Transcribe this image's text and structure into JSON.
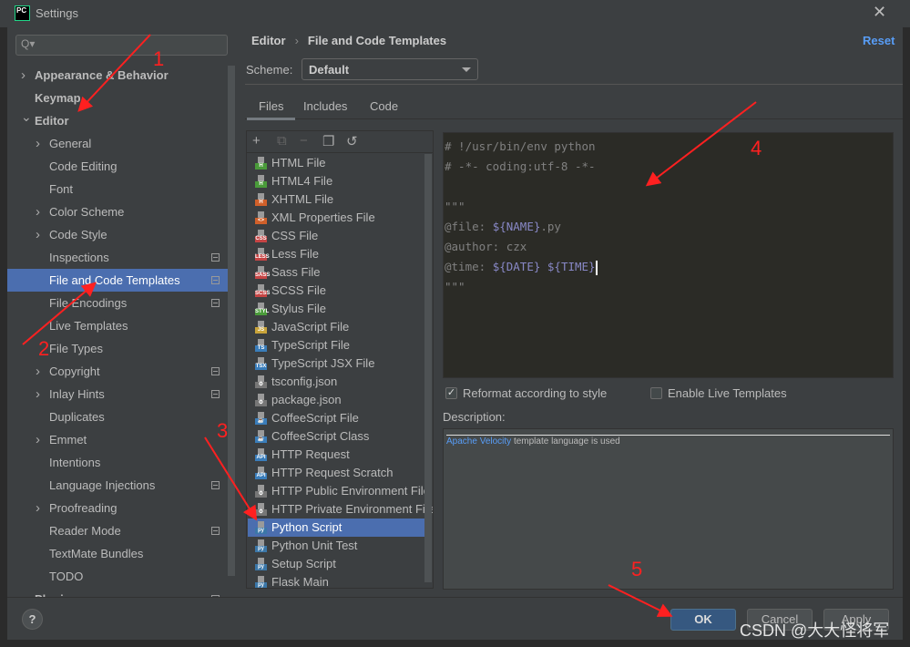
{
  "window": {
    "title": "Settings",
    "logo": "PC"
  },
  "search": {
    "placeholder": "Q▾"
  },
  "sidebar": {
    "items": [
      {
        "label": "Appearance & Behavior",
        "level": 0,
        "chevron": "right",
        "bold": true
      },
      {
        "label": "Keymap",
        "level": 0,
        "bold": true
      },
      {
        "label": "Editor",
        "level": 0,
        "chevron": "down",
        "bold": true
      },
      {
        "label": "General",
        "level": 1,
        "chevron": "right"
      },
      {
        "label": "Code Editing",
        "level": 1
      },
      {
        "label": "Font",
        "level": 1
      },
      {
        "label": "Color Scheme",
        "level": 1,
        "chevron": "right"
      },
      {
        "label": "Code Style",
        "level": 1,
        "chevron": "right"
      },
      {
        "label": "Inspections",
        "level": 1,
        "badge": true
      },
      {
        "label": "File and Code Templates",
        "level": 1,
        "selected": true,
        "badge": true
      },
      {
        "label": "File Encodings",
        "level": 1,
        "badge": true
      },
      {
        "label": "Live Templates",
        "level": 1
      },
      {
        "label": "File Types",
        "level": 1
      },
      {
        "label": "Copyright",
        "level": 1,
        "chevron": "right",
        "badge": true
      },
      {
        "label": "Inlay Hints",
        "level": 1,
        "chevron": "right",
        "badge": true
      },
      {
        "label": "Duplicates",
        "level": 1
      },
      {
        "label": "Emmet",
        "level": 1,
        "chevron": "right"
      },
      {
        "label": "Intentions",
        "level": 1
      },
      {
        "label": "Language Injections",
        "level": 1,
        "badge": true
      },
      {
        "label": "Proofreading",
        "level": 1,
        "chevron": "right"
      },
      {
        "label": "Reader Mode",
        "level": 1,
        "badge": true
      },
      {
        "label": "TextMate Bundles",
        "level": 1
      },
      {
        "label": "TODO",
        "level": 1
      },
      {
        "label": "Plugins",
        "level": 0,
        "bold": true,
        "badge": true
      }
    ]
  },
  "breadcrumb": {
    "parent": "Editor",
    "current": "File and Code Templates"
  },
  "reset_label": "Reset",
  "scheme": {
    "label": "Scheme:",
    "value": "Default"
  },
  "tabs": [
    {
      "label": "Files",
      "active": true
    },
    {
      "label": "Includes"
    },
    {
      "label": "Code"
    }
  ],
  "toolbar": {
    "add": "+",
    "copy_add": "⧉",
    "remove": "−",
    "copy": "❐",
    "reset": "↺"
  },
  "files": [
    {
      "label": "HTML File",
      "badge": "H",
      "color": "#4a9b3a"
    },
    {
      "label": "HTML4 File",
      "badge": "H",
      "color": "#4a9b3a"
    },
    {
      "label": "XHTML File",
      "badge": "H",
      "color": "#d0602a"
    },
    {
      "label": "XML Properties File",
      "badge": "<>",
      "color": "#d0602a"
    },
    {
      "label": "CSS File",
      "badge": "CSS",
      "color": "#c64545"
    },
    {
      "label": "Less File",
      "badge": "LESS",
      "color": "#c64545"
    },
    {
      "label": "Sass File",
      "badge": "SASS",
      "color": "#c64545"
    },
    {
      "label": "SCSS File",
      "badge": "SCSS",
      "color": "#c64545"
    },
    {
      "label": "Stylus File",
      "badge": "STYL",
      "color": "#4a9b3a"
    },
    {
      "label": "JavaScript File",
      "badge": "JS",
      "color": "#c9a43a"
    },
    {
      "label": "TypeScript File",
      "badge": "TS",
      "color": "#3a7dba"
    },
    {
      "label": "TypeScript JSX File",
      "badge": "TSX",
      "color": "#3a7dba"
    },
    {
      "label": "tsconfig.json",
      "badge": "⚙",
      "color": "#777777"
    },
    {
      "label": "package.json",
      "badge": "⚙",
      "color": "#777777"
    },
    {
      "label": "CoffeeScript File",
      "badge": "☕",
      "color": "#3a7dba"
    },
    {
      "label": "CoffeeScript Class",
      "badge": "☕",
      "color": "#3a7dba"
    },
    {
      "label": "HTTP Request",
      "badge": "API",
      "color": "#3a7dba"
    },
    {
      "label": "HTTP Request Scratch",
      "badge": "API",
      "color": "#3a7dba"
    },
    {
      "label": "HTTP Public Environment File",
      "badge": "⚙",
      "color": "#777777"
    },
    {
      "label": "HTTP Private Environment File",
      "badge": "⚙",
      "color": "#777777"
    },
    {
      "label": "Python Script",
      "badge": "py",
      "color": "#3b77a8",
      "selected": true
    },
    {
      "label": "Python Unit Test",
      "badge": "py",
      "color": "#3b77a8"
    },
    {
      "label": "Setup Script",
      "badge": "py",
      "color": "#3b77a8"
    },
    {
      "label": "Flask Main",
      "badge": "py",
      "color": "#3b77a8"
    }
  ],
  "code": {
    "l1": "# !/usr/bin/env python",
    "l2": "# -*- coding:utf-8 -*-",
    "l4": "\"\"\"",
    "l5a": "@file: ",
    "l5b": "${NAME}",
    "l5c": ".py",
    "l6": "@author: czx",
    "l7a": "@time: ",
    "l7b": "${DATE}",
    "l7c": " ",
    "l7d": "${TIME}",
    "l8": "\"\"\""
  },
  "options": {
    "reformat": {
      "label": "Reformat according to style",
      "checked": true
    },
    "live": {
      "label": "Enable Live Templates",
      "checked": false
    }
  },
  "description": {
    "label": "Description:",
    "link": "Apache Velocity",
    "text": " template language is used"
  },
  "footer": {
    "help": "?",
    "ok": "OK",
    "cancel": "Cancel",
    "apply": "Apply"
  },
  "annotations": {
    "n1": "1",
    "n2": "2",
    "n3": "3",
    "n4": "4",
    "n5": "5",
    "color": "#ff2020"
  },
  "watermark": "CSDN @大大怪将军"
}
